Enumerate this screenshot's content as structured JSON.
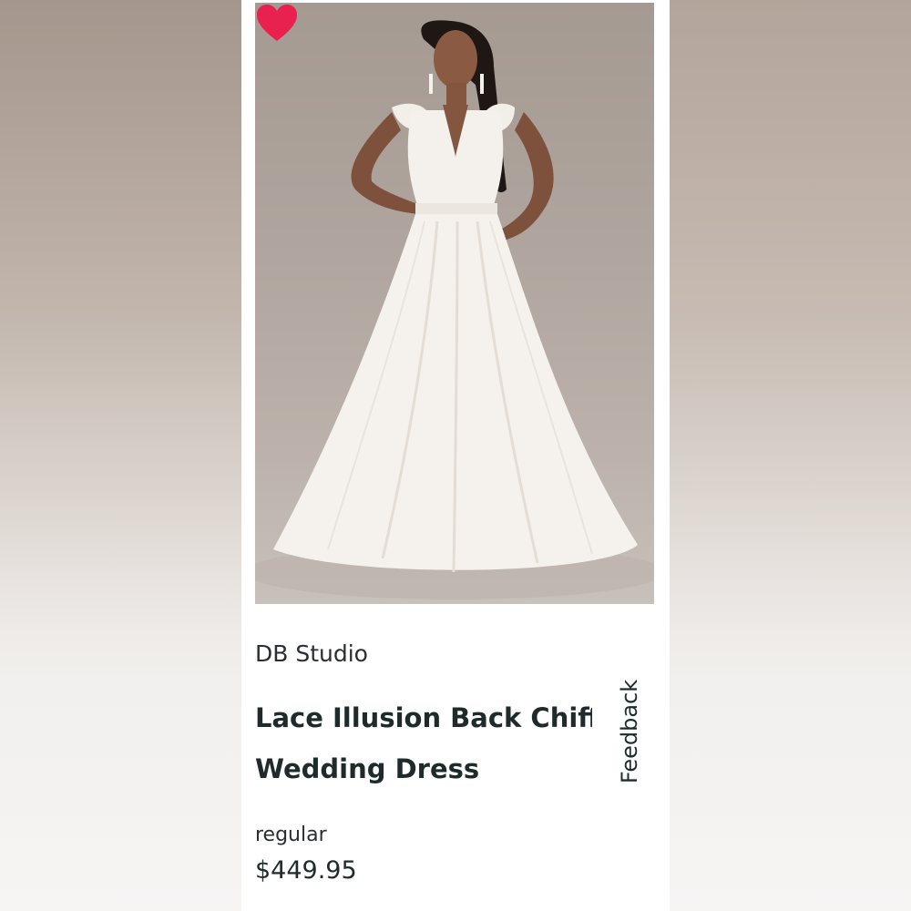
{
  "product": {
    "brand": "DB Studio",
    "title_line1": "Lace Illusion Back Chiffon",
    "title_line2": "Wedding Dress",
    "price_type": "regular",
    "price": "$449.95",
    "image_alt": "Model wearing white lace V-neck chiffon wedding gown",
    "favorite_icon": "heart-icon",
    "favorite_color": "#e8214f"
  },
  "feedback": {
    "label": "Feedback"
  }
}
